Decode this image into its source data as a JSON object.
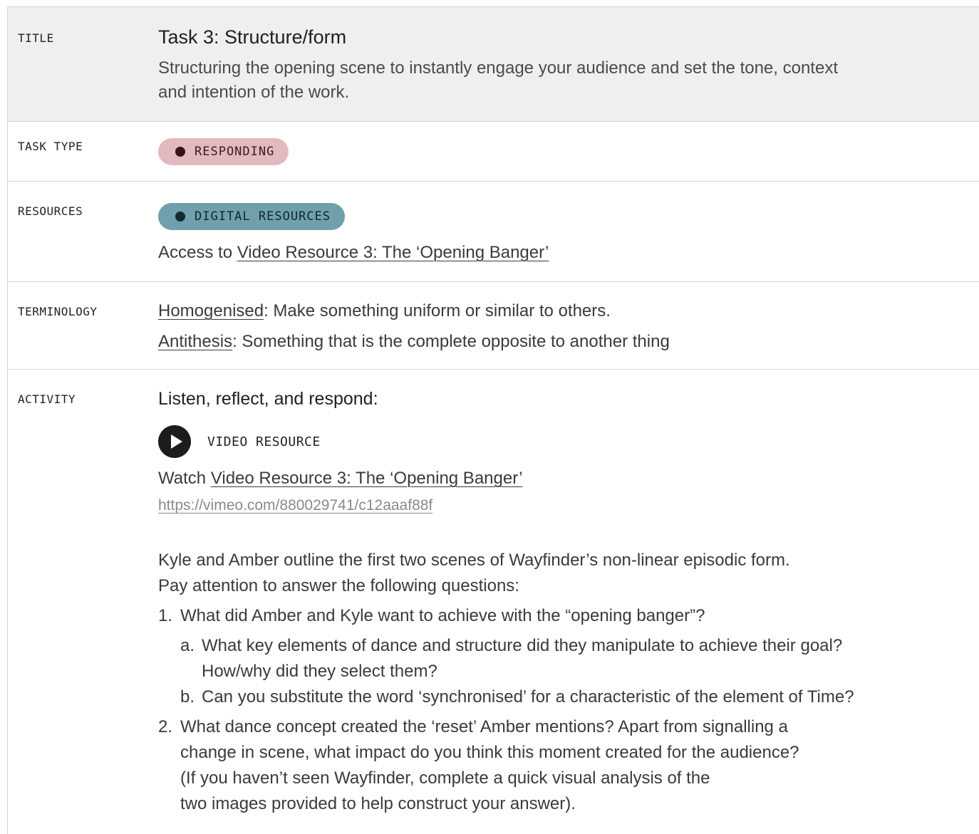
{
  "rows": {
    "title": {
      "label": "TITLE",
      "heading": "Task 3: Structure/form",
      "subtitle": "Structuring the opening scene to instantly engage your audience and set the tone, context and intention of the work."
    },
    "task_type": {
      "label": "TASK TYPE",
      "pill": "RESPONDING"
    },
    "resources": {
      "label": "RESOURCES",
      "pill": "DIGITAL RESOURCES",
      "access_prefix": "Access to",
      "access_link": "Video Resource 3: The ‘Opening Banger’"
    },
    "terminology": {
      "label": "TERMINOLOGY",
      "terms": [
        {
          "term": "Homogenised",
          "definition": ": Make something uniform or similar to others."
        },
        {
          "term": "Antithesis",
          "definition": ": Something that is the complete opposite to another thing"
        }
      ]
    },
    "activity": {
      "label": "ACTIVITY",
      "heading": "Listen, reflect, and respond:",
      "video_label": "VIDEO RESOURCE",
      "watch_prefix": "Watch",
      "watch_link": "Video Resource 3: The ‘Opening Banger’",
      "url": "https://vimeo.com/880029741/c12aaaf88f",
      "intro_1": "Kyle and Amber outline the first two scenes of Wayfinder’s non-linear episodic form.",
      "intro_2": "Pay attention to answer the following questions:",
      "questions": [
        {
          "num": "1.",
          "text": "What did Amber and Kyle want to achieve with the “opening banger”?",
          "sub": [
            {
              "num": "a.",
              "text_1": "What key elements of dance and structure did they manipulate to achieve their goal?",
              "text_2": "How/why did they select them?"
            },
            {
              "num": "b.",
              "text_1": "Can you substitute the word ‘synchronised’ for a characteristic of the element of Time?"
            }
          ]
        },
        {
          "num": "2.",
          "lines": [
            "What dance concept created the ‘reset’ Amber mentions? Apart from signalling a",
            "change in scene, what impact do you think this moment created for the audience?",
            "(If you haven’t seen Wayfinder, complete a quick visual analysis of the",
            "two images provided to help construct your answer)."
          ]
        }
      ]
    }
  },
  "colors": {
    "title_row_bg": "#eef0ef",
    "responding_pill": "#e3b9c0",
    "digital_pill": "#6fa0ac"
  },
  "icons": {
    "video": "play-icon",
    "pill_marker": "dot-icon"
  }
}
